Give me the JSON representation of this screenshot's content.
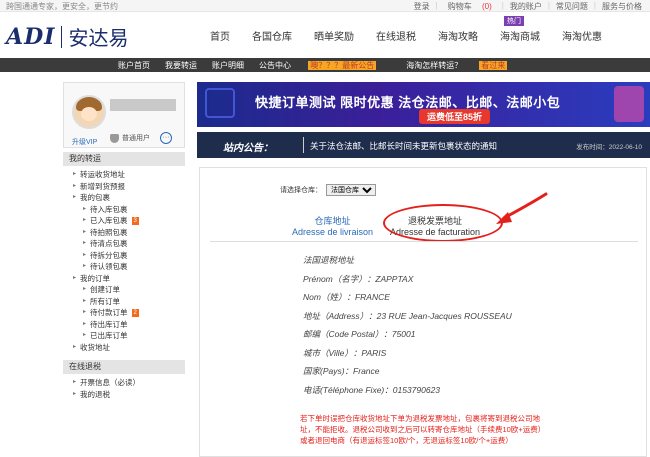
{
  "topbar": {
    "slogan": "跨国通通专家，更安全，更节约",
    "links": [
      "登录",
      "购物车",
      "我的账户",
      "常见问题",
      "服务与价格"
    ],
    "cart_count": "(0)"
  },
  "header": {
    "logo_en": "ADI",
    "logo_cn": "安达易",
    "nav": [
      "首页",
      "各国仓库",
      "晒单奖励",
      "在线退税",
      "海淘攻略",
      "海淘商城",
      "海淘优惠"
    ],
    "hot_badge": "热门"
  },
  "subnav": {
    "items": [
      "账户首页",
      "我要转运",
      "账户明细",
      "公告中心"
    ],
    "notice_tag": "噢？？？最新公告",
    "question": "海淘怎样转运？",
    "look_tag": "看过来"
  },
  "sidebar": {
    "vip_label": "升级VIP",
    "member_label": "普通用户",
    "chat_icon": "···",
    "section1_title": "我的转运",
    "menu": [
      {
        "label": "转运收货地址",
        "level": 1
      },
      {
        "label": "新增到货预报",
        "level": 1
      },
      {
        "label": "我的包裹",
        "level": 1
      },
      {
        "label": "待入库包裹",
        "level": 2
      },
      {
        "label": "已入库包裹",
        "level": 2,
        "badge": "3"
      },
      {
        "label": "待拍照包裹",
        "level": 2
      },
      {
        "label": "待清点包裹",
        "level": 2
      },
      {
        "label": "待拆分包裹",
        "level": 2
      },
      {
        "label": "待认领包裹",
        "level": 2
      },
      {
        "label": "我的订单",
        "level": 1
      },
      {
        "label": "创建订单",
        "level": 2
      },
      {
        "label": "所有订单",
        "level": 2
      },
      {
        "label": "待付款订单",
        "level": 2,
        "badge": "2"
      },
      {
        "label": "待出库订单",
        "level": 2
      },
      {
        "label": "已出库订单",
        "level": 2
      },
      {
        "label": "收货地址",
        "level": 1
      }
    ],
    "section2_title": "在线退税",
    "menu2": [
      {
        "label": "开票信息（必读）",
        "level": 1
      },
      {
        "label": "我的退税",
        "level": 1
      }
    ]
  },
  "banner": {
    "title": "快捷订单测试 限时优惠 法仓法邮、比邮、法邮小包",
    "pill": "运费低至85折"
  },
  "notice": {
    "label": "站内公告：",
    "text": "关于法仓法邮、比邮长时间未更新包裹状态的通知",
    "time": "发布时间：2022-06-10"
  },
  "panel": {
    "warehouse_label": "请选择仓库：",
    "warehouse_selected": "法国仓库",
    "tab_shipping_cn": "仓库地址",
    "tab_shipping_fr": "Adresse de livraison",
    "tab_billing_cn": "退税发票地址",
    "tab_billing_fr": "Adresse de facturation",
    "address": [
      "法国退税地址",
      "Prénom（名字）：ZAPPTAX",
      "Nom（姓）：FRANCE",
      "地址（Address）：23 RUE Jean-Jacques ROUSSEAU",
      "邮编（Code Postal）：75001",
      "城市（Ville）：PARIS",
      "国家(Pays)：France",
      "电话(Téléphone Fixe)：0153790623"
    ],
    "warning": "若下单时误把仓库收货地址下单为退税发票地址，包裹将寄到退税公司地址，不能拒收。退税公司收到之后可以转寄仓库地址（手续费10欧+运费）或者退回电商（有退运标签10欧/个，无退运标签10欧/个+运费）"
  },
  "colors": {
    "accent_red": "#e3201b",
    "link_blue": "#2a6ab8",
    "dark_bar": "#3b3b3b",
    "notice_bg": "#1f2d4d"
  }
}
